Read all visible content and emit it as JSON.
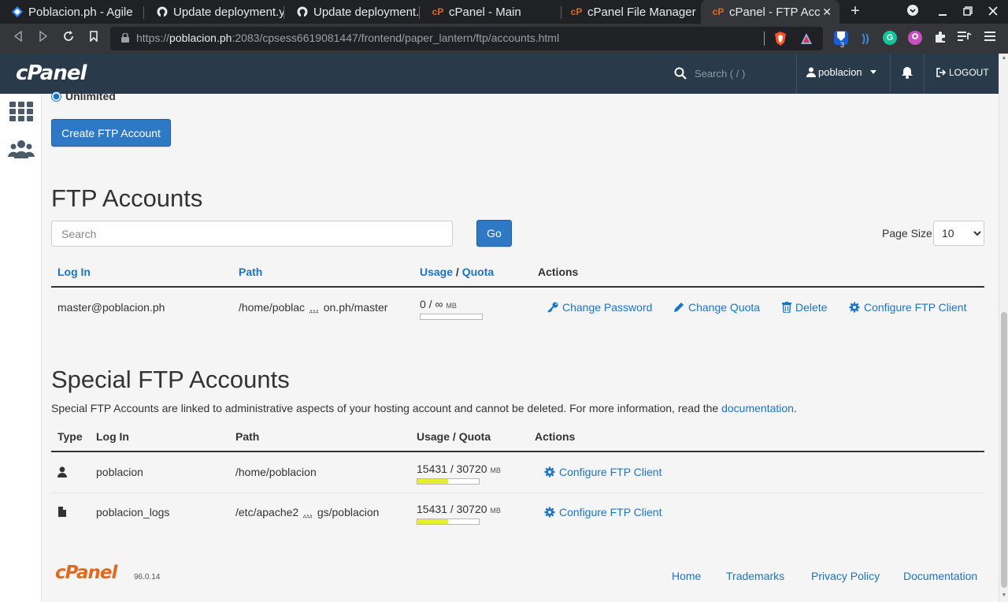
{
  "browser": {
    "tabs": [
      {
        "title": "Poblacion.ph - Agile",
        "icon": "diamond-icon"
      },
      {
        "title": "Update deployment.y",
        "icon": "github-icon"
      },
      {
        "title": "Update deployment.y",
        "icon": "github-icon"
      },
      {
        "title": "cPanel - Main",
        "icon": "cpanel-icon"
      },
      {
        "title": "cPanel File Manager",
        "icon": "cpanel-icon"
      },
      {
        "title": "cPanel - FTP Acc",
        "icon": "cpanel-icon",
        "active": true
      }
    ],
    "url_scheme": "https://",
    "url_host": "poblacion.ph",
    "url_rest": ":2083/cpsess6619081447/frontend/paper_lantern/ftp/accounts.html",
    "extension_badge": "3"
  },
  "header": {
    "logo": "cPanel",
    "search_placeholder": "Search ( / )",
    "username": "poblacion",
    "logout_label": "LOGOUT"
  },
  "quota_option": {
    "label": "Unlimited"
  },
  "create_button_label": "Create FTP Account",
  "ftp_accounts": {
    "title": "FTP Accounts",
    "search_placeholder": "Search",
    "go_label": "Go",
    "page_size_label": "Page Size",
    "page_size_value": "10",
    "columns": {
      "login": "Log In",
      "path": "Path",
      "usage": "Usage",
      "slash": "/",
      "quota": "Quota",
      "actions": "Actions"
    },
    "rows": [
      {
        "login": "master@poblacion.ph",
        "path_start": "/home/poblac",
        "path_ellipsis": "...",
        "path_end": "on.ph/master",
        "usage_text": "0 / ∞",
        "usage_unit": "MB",
        "usage_fraction": 0,
        "actions": {
          "change_password": "Change Password",
          "change_quota": "Change Quota",
          "delete": "Delete",
          "configure": "Configure FTP Client"
        }
      }
    ]
  },
  "special_accounts": {
    "title": "Special FTP Accounts",
    "description": "Special FTP Accounts are linked to administrative aspects of your hosting account and cannot be deleted. For more information, read the",
    "doc_link": "documentation",
    "period": ".",
    "columns": {
      "type": "Type",
      "login": "Log In",
      "path": "Path",
      "usage_quota": "Usage / Quota",
      "actions": "Actions"
    },
    "rows": [
      {
        "type_icon": "user-icon",
        "login": "poblacion",
        "path_start": "/home/poblacion",
        "usage_text": "15431 / 30720",
        "usage_unit": "MB",
        "usage_fraction": 0.5,
        "configure": "Configure FTP Client"
      },
      {
        "type_icon": "file-icon",
        "login": "poblacion_logs",
        "path_start": "/etc/apache2",
        "path_ellipsis": "...",
        "path_end": "gs/poblacion",
        "usage_text": "15431 / 30720",
        "usage_unit": "MB",
        "usage_fraction": 0.5,
        "configure": "Configure FTP Client"
      }
    ]
  },
  "footer": {
    "logo": "cPanel",
    "version": "96.0.14",
    "links": [
      "Home",
      "Trademarks",
      "Privacy Policy",
      "Documentation"
    ]
  },
  "colors": {
    "header_bg": "#293a4a",
    "link": "#1a74c4",
    "button": "#2e79c5",
    "usage_fill": "#e6ee2e",
    "footer_logo": "#e2691d"
  }
}
